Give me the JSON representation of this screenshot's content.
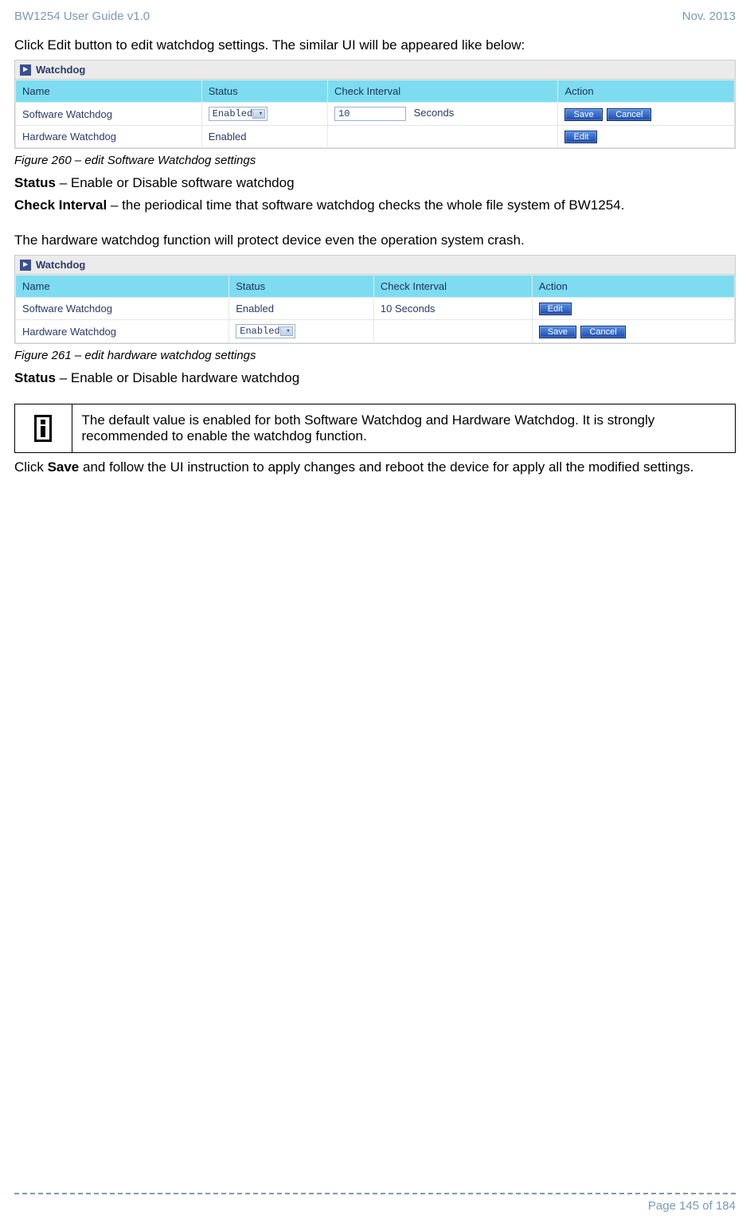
{
  "header": {
    "left": "BW1254 User Guide v1.0",
    "right": "Nov.  2013"
  },
  "intro1": "Click Edit button to edit watchdog settings. The similar UI will be appeared like below:",
  "table1": {
    "title": "Watchdog",
    "headers": {
      "name": "Name",
      "status": "Status",
      "check": "Check Interval",
      "action": "Action"
    },
    "row1": {
      "name": "Software Watchdog",
      "status_value": "Enabled",
      "interval_value": "10",
      "interval_unit": "Seconds",
      "btn_save": "Save",
      "btn_cancel": "Cancel"
    },
    "row2": {
      "name": "Hardware Watchdog",
      "status_text": "Enabled",
      "btn_edit": "Edit"
    }
  },
  "caption1": "Figure 260 – edit Software Watchdog settings",
  "status_line1a": "Status",
  "status_line1b": " – Enable or Disable software watchdog",
  "check_line_a": "Check Interval",
  "check_line_b": " – the periodical time that software watchdog checks the whole file system of BW1254.",
  "intro2": "The hardware watchdog function will protect device even the operation system crash.",
  "table2": {
    "title": "Watchdog",
    "headers": {
      "name": "Name",
      "status": "Status",
      "check": "Check Interval",
      "action": "Action"
    },
    "row1": {
      "name": "Software Watchdog",
      "status_text": "Enabled",
      "interval_text": "10 Seconds",
      "btn_edit": "Edit"
    },
    "row2": {
      "name": "Hardware Watchdog",
      "status_value": "Enabled",
      "btn_save": "Save",
      "btn_cancel": "Cancel"
    }
  },
  "caption2": "Figure 261 – edit hardware watchdog settings",
  "status_line2a": "Status",
  "status_line2b": " – Enable or Disable hardware watchdog",
  "info_text": "The default value is enabled for both Software Watchdog and Hardware Watchdog. It is strongly recommended to enable the watchdog function.",
  "closing_a": "Click ",
  "closing_b": "Save",
  "closing_c": " and follow the UI instruction to apply changes and reboot the device for apply all the modified settings.",
  "footer": {
    "page": "Page 145 of 184"
  }
}
